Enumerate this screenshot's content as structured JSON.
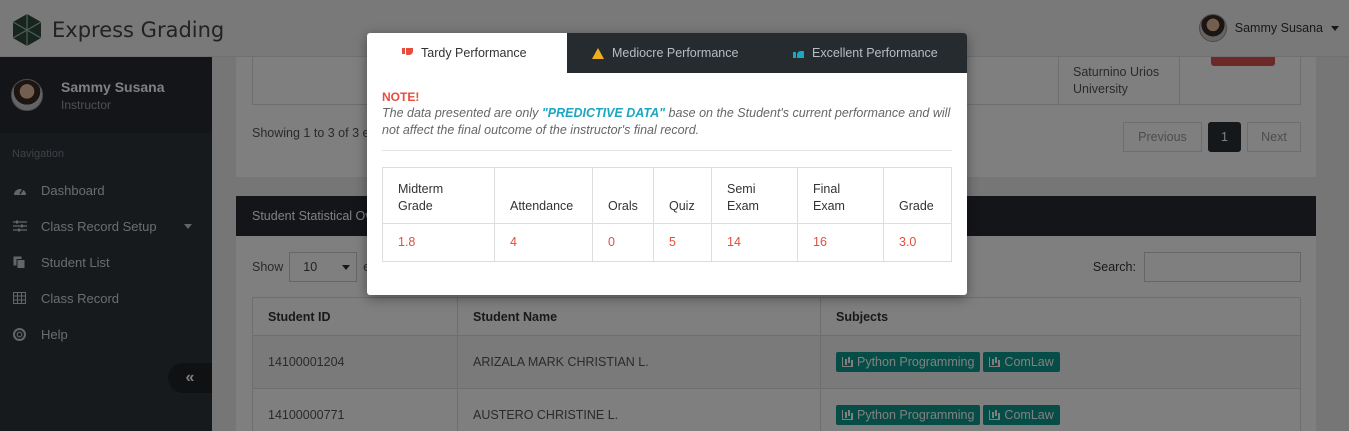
{
  "app": {
    "title": "Express Grading"
  },
  "user": {
    "name": "Sammy Susana",
    "role": "Instructor"
  },
  "sidebar": {
    "nav_title": "Navigation",
    "items": [
      {
        "label": "Dashboard",
        "icon": "dashboard-icon"
      },
      {
        "label": "Class Record Setup",
        "icon": "sliders-icon"
      },
      {
        "label": "Student List",
        "icon": "copy-icon"
      },
      {
        "label": "Class Record",
        "icon": "table-icon"
      },
      {
        "label": "Help",
        "icon": "lifebuoy-icon"
      }
    ],
    "collapse_label": "«"
  },
  "top_card": {
    "university": "Saturnino Urios University",
    "showing": "Showing 1 to 3 of 3 e",
    "pager": {
      "previous": "Previous",
      "current": "1",
      "next": "Next"
    }
  },
  "stats_card": {
    "title": "Student Statistical Ov",
    "show_label": "Show",
    "show_value": "10",
    "entries_stub": "e",
    "search_label": "Search:",
    "columns": [
      "Student ID",
      "Student Name",
      "Subjects"
    ],
    "rows": [
      {
        "id": "14100001204",
        "name": "ARIZALA MARK CHRISTIAN L.",
        "subjects": [
          "Python Programming",
          "ComLaw"
        ]
      },
      {
        "id": "14100000771",
        "name": "AUSTERO CHRISTINE L.",
        "subjects": [
          "Python Programming",
          "ComLaw"
        ]
      }
    ]
  },
  "modal": {
    "tabs": [
      {
        "label": "Tardy Performance",
        "icon": "thumbs-down-icon",
        "active": true
      },
      {
        "label": "Mediocre Performance",
        "icon": "warning-icon",
        "active": false
      },
      {
        "label": "Excellent Performance",
        "icon": "thumbs-up-icon",
        "active": false
      }
    ],
    "note_title": "NOTE!",
    "note_pre": "The data presented are only ",
    "note_highlight": "\"PREDICTIVE DATA\"",
    "note_post": " base on the Student's current performance and will not affect the final outcome of the instructor's final record.",
    "table": {
      "headers": [
        [
          "Midterm",
          "Grade"
        ],
        [
          "Attendance",
          ""
        ],
        [
          "Orals",
          ""
        ],
        [
          "Quiz",
          ""
        ],
        [
          "Semi",
          "Exam"
        ],
        [
          "Final",
          "Exam"
        ],
        [
          "Grade",
          ""
        ]
      ],
      "values": [
        "1.8",
        "4",
        "0",
        "5",
        "14",
        "16",
        "3.0"
      ]
    }
  },
  "colors": {
    "sidebar": "#2f353b",
    "danger": "#e74c3c",
    "teal": "#0f9a8e",
    "info": "#1aa7c2",
    "warning": "#f0ad1f"
  }
}
